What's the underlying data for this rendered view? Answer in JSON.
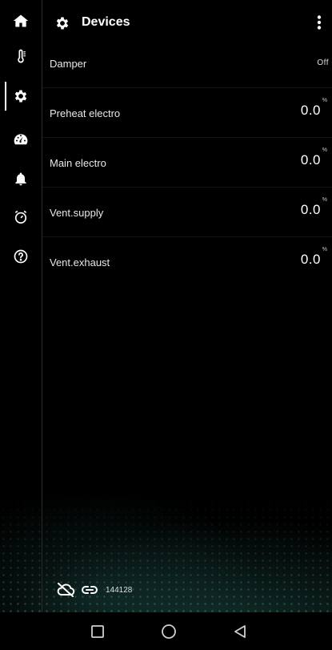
{
  "header": {
    "title": "Devices"
  },
  "sidebar": {
    "items": [
      {
        "icon": "home-icon"
      },
      {
        "icon": "thermometer-icon"
      },
      {
        "icon": "gear-icon",
        "active": true
      },
      {
        "icon": "gauge-icon"
      },
      {
        "icon": "bell-icon"
      },
      {
        "icon": "timer-icon"
      },
      {
        "icon": "help-icon"
      }
    ]
  },
  "devices": [
    {
      "label": "Damper",
      "value": "Off",
      "unit": ""
    },
    {
      "label": "Preheat electro",
      "value": "0.0",
      "unit": "%"
    },
    {
      "label": "Main electro",
      "value": "0.0",
      "unit": "%"
    },
    {
      "label": "Vent.supply",
      "value": "0.0",
      "unit": "%"
    },
    {
      "label": "Vent.exhaust",
      "value": "0.0",
      "unit": "%"
    }
  ],
  "status": {
    "device_id": "144128"
  },
  "colors": {
    "background": "#000000",
    "text": "#ffffff",
    "accent_glow": "#2a6e64"
  }
}
